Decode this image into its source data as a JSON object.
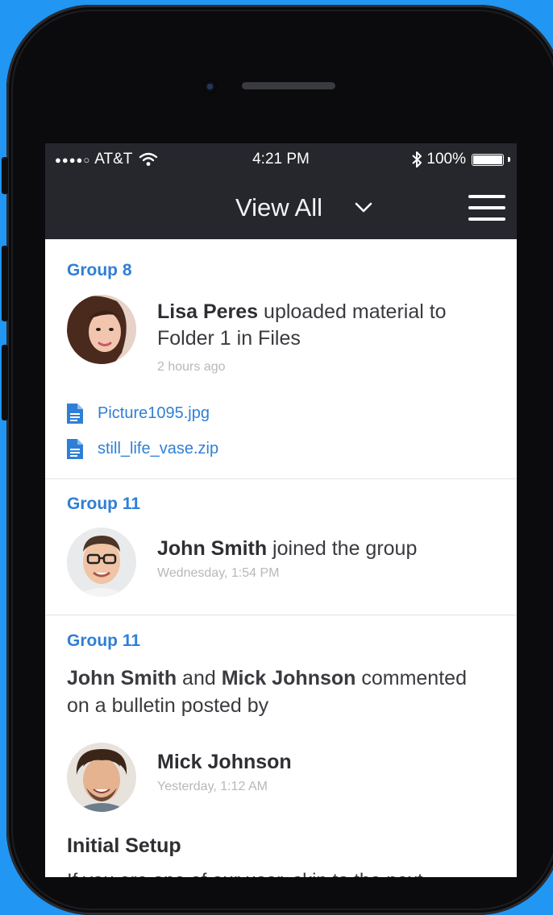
{
  "status_bar": {
    "signal": "●●●●○",
    "carrier": "AT&T",
    "time": "4:21 PM",
    "battery_text": "100%",
    "icons": [
      "wifi-icon",
      "bluetooth-icon",
      "battery-icon"
    ]
  },
  "nav": {
    "title": "View All",
    "icons": [
      "chevron-down-icon",
      "hamburger-menu-icon"
    ]
  },
  "colors": {
    "background": "#2196f3",
    "bar": "#26272d",
    "accent": "#2f7fd6"
  },
  "feed": [
    {
      "group": "Group 8",
      "actor": "Lisa Peres",
      "action_line1": " uploaded material to",
      "action_line2": "Folder 1 in Files",
      "timestamp": "2 hours ago",
      "files": [
        "Picture1095.jpg",
        "still_life_vase.zip"
      ]
    },
    {
      "group": "Group 11",
      "actor": "John Smith",
      "action": " joined the group",
      "timestamp": "Wednesday, 1:54 PM"
    },
    {
      "group": "Group 11",
      "actor1": "John Smith",
      "conj": " and ",
      "actor2": "Mick Johnson",
      "action_line1": " commented",
      "action_line2": "on a bulletin posted by",
      "poster": "Mick Johnson",
      "timestamp": "Yesterday, 1:12 AM",
      "post_title": "Initial Setup",
      "post_body": "If you are one of our user, skip to the next"
    }
  ]
}
